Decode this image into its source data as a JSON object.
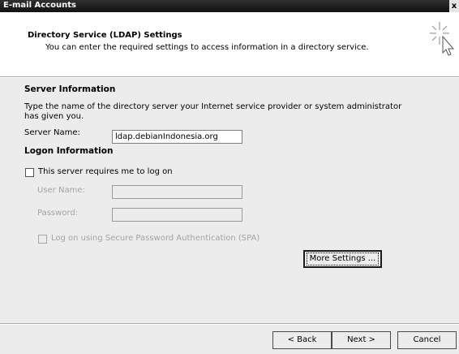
{
  "window": {
    "title": "E-mail Accounts",
    "close_glyph": "x"
  },
  "header": {
    "title": "Directory Service (LDAP) Settings",
    "subtitle": "You can enter the required settings to access information in a directory service.",
    "icon": "wizard-sparkle-cursor-icon"
  },
  "server_info": {
    "heading": "Server Information",
    "description_line1": "Type the name of the directory server your Internet service provider or system administrator",
    "description_line2": "has given you.",
    "server_name_label": "Server Name:",
    "server_name_value": "ldap.debianIndonesia.org"
  },
  "logon_info": {
    "heading": "Logon Information",
    "requires_logon_label": "This server requires me to log on",
    "requires_logon_checked": false,
    "user_name_label": "User Name:",
    "user_name_value": "",
    "password_label": "Password:",
    "password_value": "",
    "spa_label": "Log on using Secure Password Authentication (SPA)",
    "spa_checked": false
  },
  "buttons": {
    "more_settings": "More Settings ...",
    "back": "< Back",
    "next": "Next >",
    "cancel": "Cancel"
  }
}
